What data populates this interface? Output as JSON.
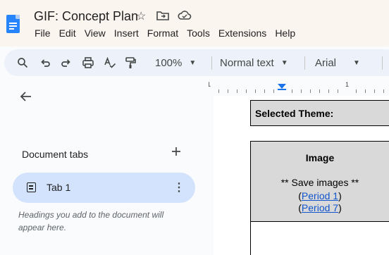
{
  "app": {
    "title": "GIF: Concept Plan",
    "icons": [
      "star-icon",
      "move-folder-icon",
      "cloud-status-icon"
    ]
  },
  "menu": [
    "File",
    "Edit",
    "View",
    "Insert",
    "Format",
    "Tools",
    "Extensions",
    "Help"
  ],
  "toolbar": {
    "zoom": "100%",
    "style": "Normal text",
    "font": "Arial"
  },
  "ruler": {
    "labels": [
      "1",
      "1"
    ]
  },
  "side_panel": {
    "tabs_title": "Document tabs",
    "tab_name": "Tab 1",
    "hint": "Headings you add to the document will appear here."
  },
  "document": {
    "theme_label": "Selected Theme:",
    "image_heading": "Image",
    "save_note": "** Save images **",
    "period1_open": "(",
    "period1_link": "Period 1",
    "period1_close": ")",
    "period7_open": "(",
    "period7_link": "Period 7",
    "period7_close": ")"
  },
  "colors": {
    "accent": "#1a73e8",
    "selected_tab": "#d3e3fd",
    "table_fill": "#d9d9d9",
    "link": "#1155cc"
  }
}
